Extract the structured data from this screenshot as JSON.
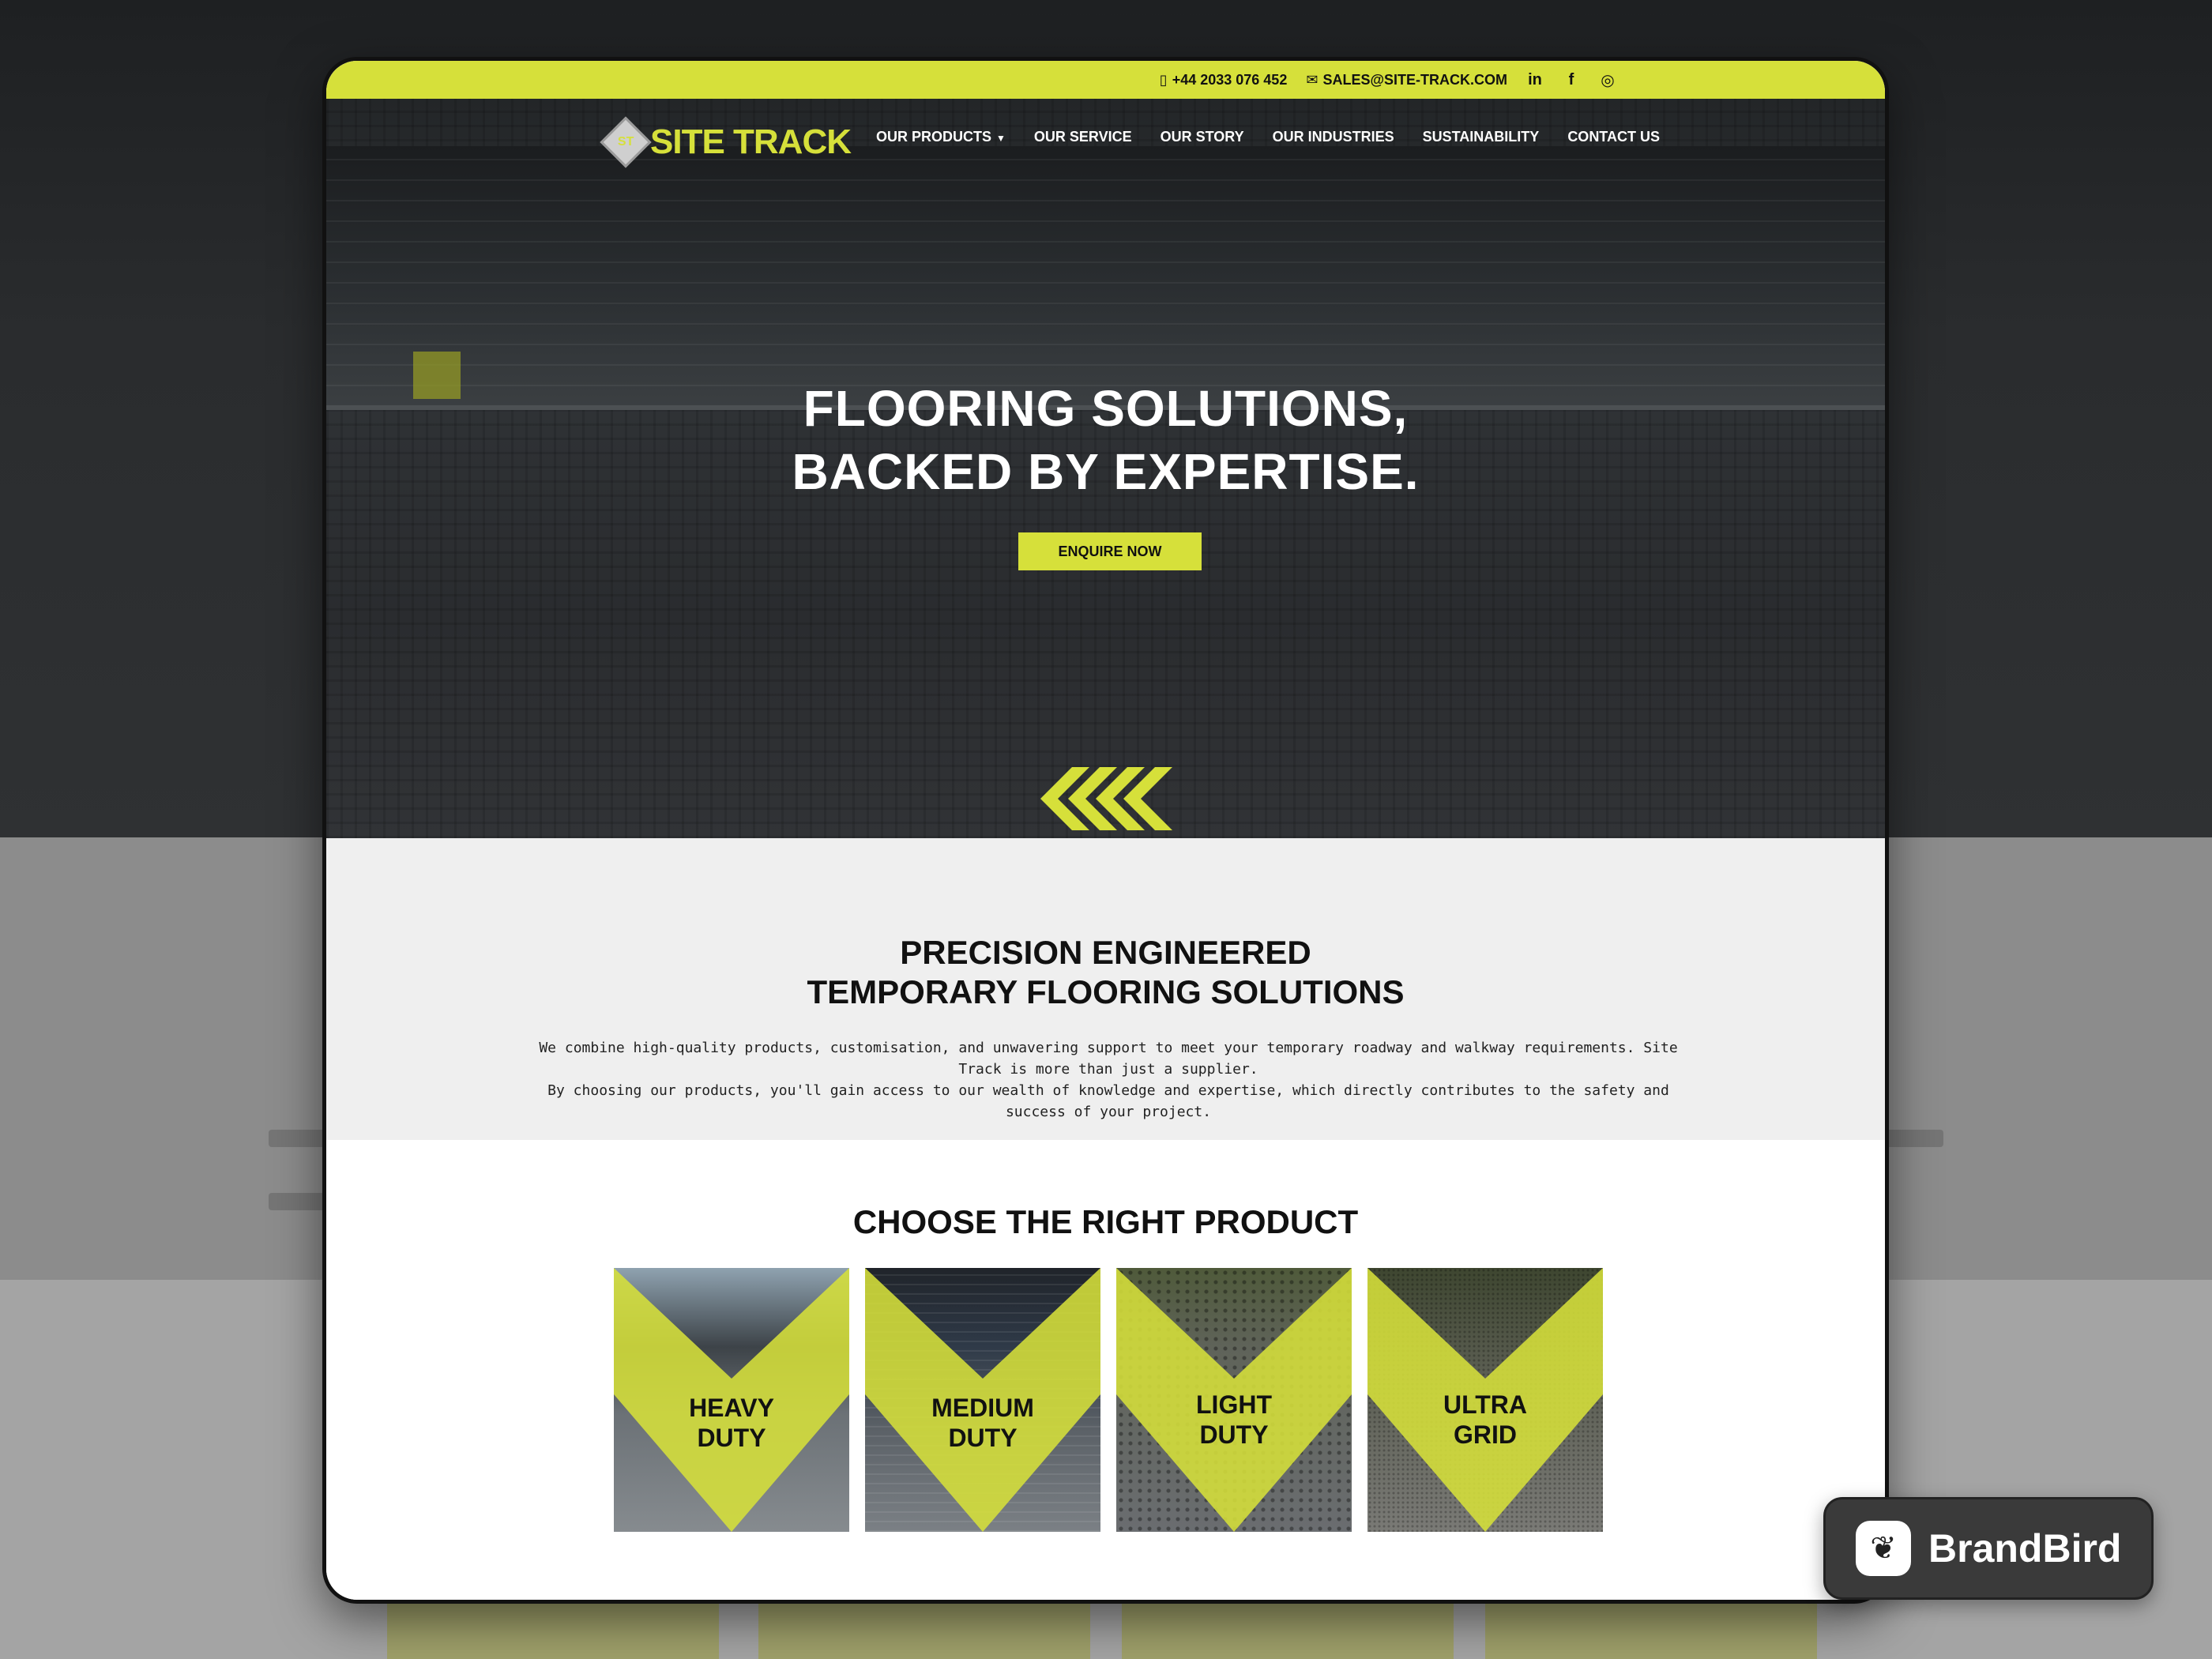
{
  "topbar": {
    "phone": "+44 2033 076 452",
    "email": "SALES@SITE-TRACK.COM",
    "social": [
      "linkedin-icon",
      "facebook-icon",
      "instagram-icon"
    ]
  },
  "brand": {
    "name": "SITE TRACK",
    "mark": "ST",
    "accent": "#d6e03a"
  },
  "nav": {
    "items": [
      "OUR PRODUCTS",
      "OUR SERVICE",
      "OUR STORY",
      "OUR INDUSTRIES",
      "SUSTAINABILITY",
      "CONTACT US"
    ]
  },
  "hero": {
    "line1": "FLOORING SOLUTIONS,",
    "line2": "BACKED BY EXPERTISE.",
    "cta": "ENQUIRE NOW"
  },
  "intro": {
    "title1": "PRECISION ENGINEERED",
    "title2": "TEMPORARY FLOORING SOLUTIONS",
    "para1": "We combine high-quality products, customisation, and unwavering support to meet your temporary roadway and walkway requirements. Site Track is more than just a supplier.",
    "para2": "By choosing our products, you'll gain access to our wealth of knowledge and expertise, which directly contributes to the safety and success of your project."
  },
  "products": {
    "title": "CHOOSE THE RIGHT PRODUCT",
    "cards": [
      {
        "line1": "HEAVY",
        "line2": "DUTY"
      },
      {
        "line1": "MEDIUM",
        "line2": "DUTY"
      },
      {
        "line1": "LIGHT",
        "line2": "DUTY"
      },
      {
        "line1": "ULTRA",
        "line2": "GRID"
      }
    ]
  },
  "badge": {
    "text": "BrandBird"
  }
}
